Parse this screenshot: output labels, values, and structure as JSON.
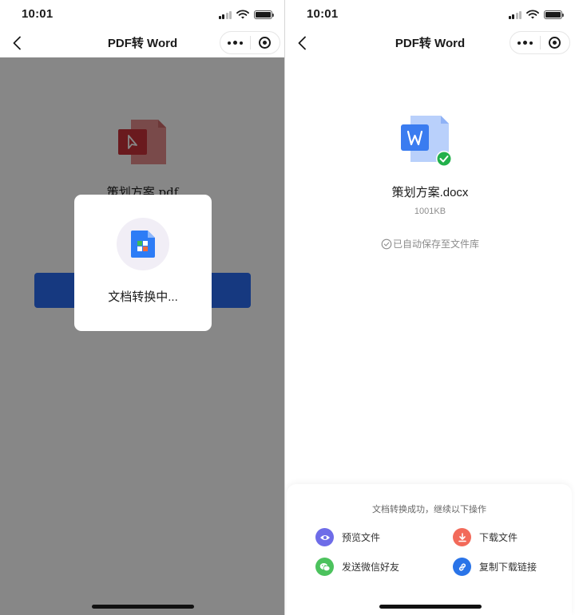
{
  "status_bar": {
    "time": "10:01"
  },
  "colors": {
    "primary_blue": "#2a6cf1",
    "preview_purple": "#6e6ce8",
    "download_red": "#f26a5a",
    "wechat_green": "#4cc25d",
    "link_blue": "#2a74e8",
    "success_green": "#22b04b",
    "pdf_red": "#c8323a"
  },
  "left_screen": {
    "nav": {
      "title": "PDF转 Word",
      "back_icon": "chevron-left-icon",
      "more_icon": "more-dots-icon",
      "close_icon": "target-close-icon"
    },
    "file": {
      "name": "策划方案.pdf",
      "icon": "pdf-file-icon"
    },
    "loading": {
      "text": "文档转换中...",
      "icon": "converting-doc-icon"
    }
  },
  "right_screen": {
    "nav": {
      "title": "PDF转 Word",
      "back_icon": "chevron-left-icon",
      "more_icon": "more-dots-icon",
      "close_icon": "target-close-icon"
    },
    "file": {
      "name": "策划方案.docx",
      "size": "1001KB",
      "icon": "word-file-icon",
      "badge_icon": "check-badge-icon"
    },
    "saved_text": "已自动保存至文件库",
    "panel": {
      "title": "文档转换成功，继续以下操作",
      "actions": [
        {
          "label": "预览文件",
          "icon": "eye-icon"
        },
        {
          "label": "下载文件",
          "icon": "download-icon"
        },
        {
          "label": "发送微信好友",
          "icon": "wechat-icon"
        },
        {
          "label": "复制下载链接",
          "icon": "link-icon"
        }
      ]
    }
  }
}
